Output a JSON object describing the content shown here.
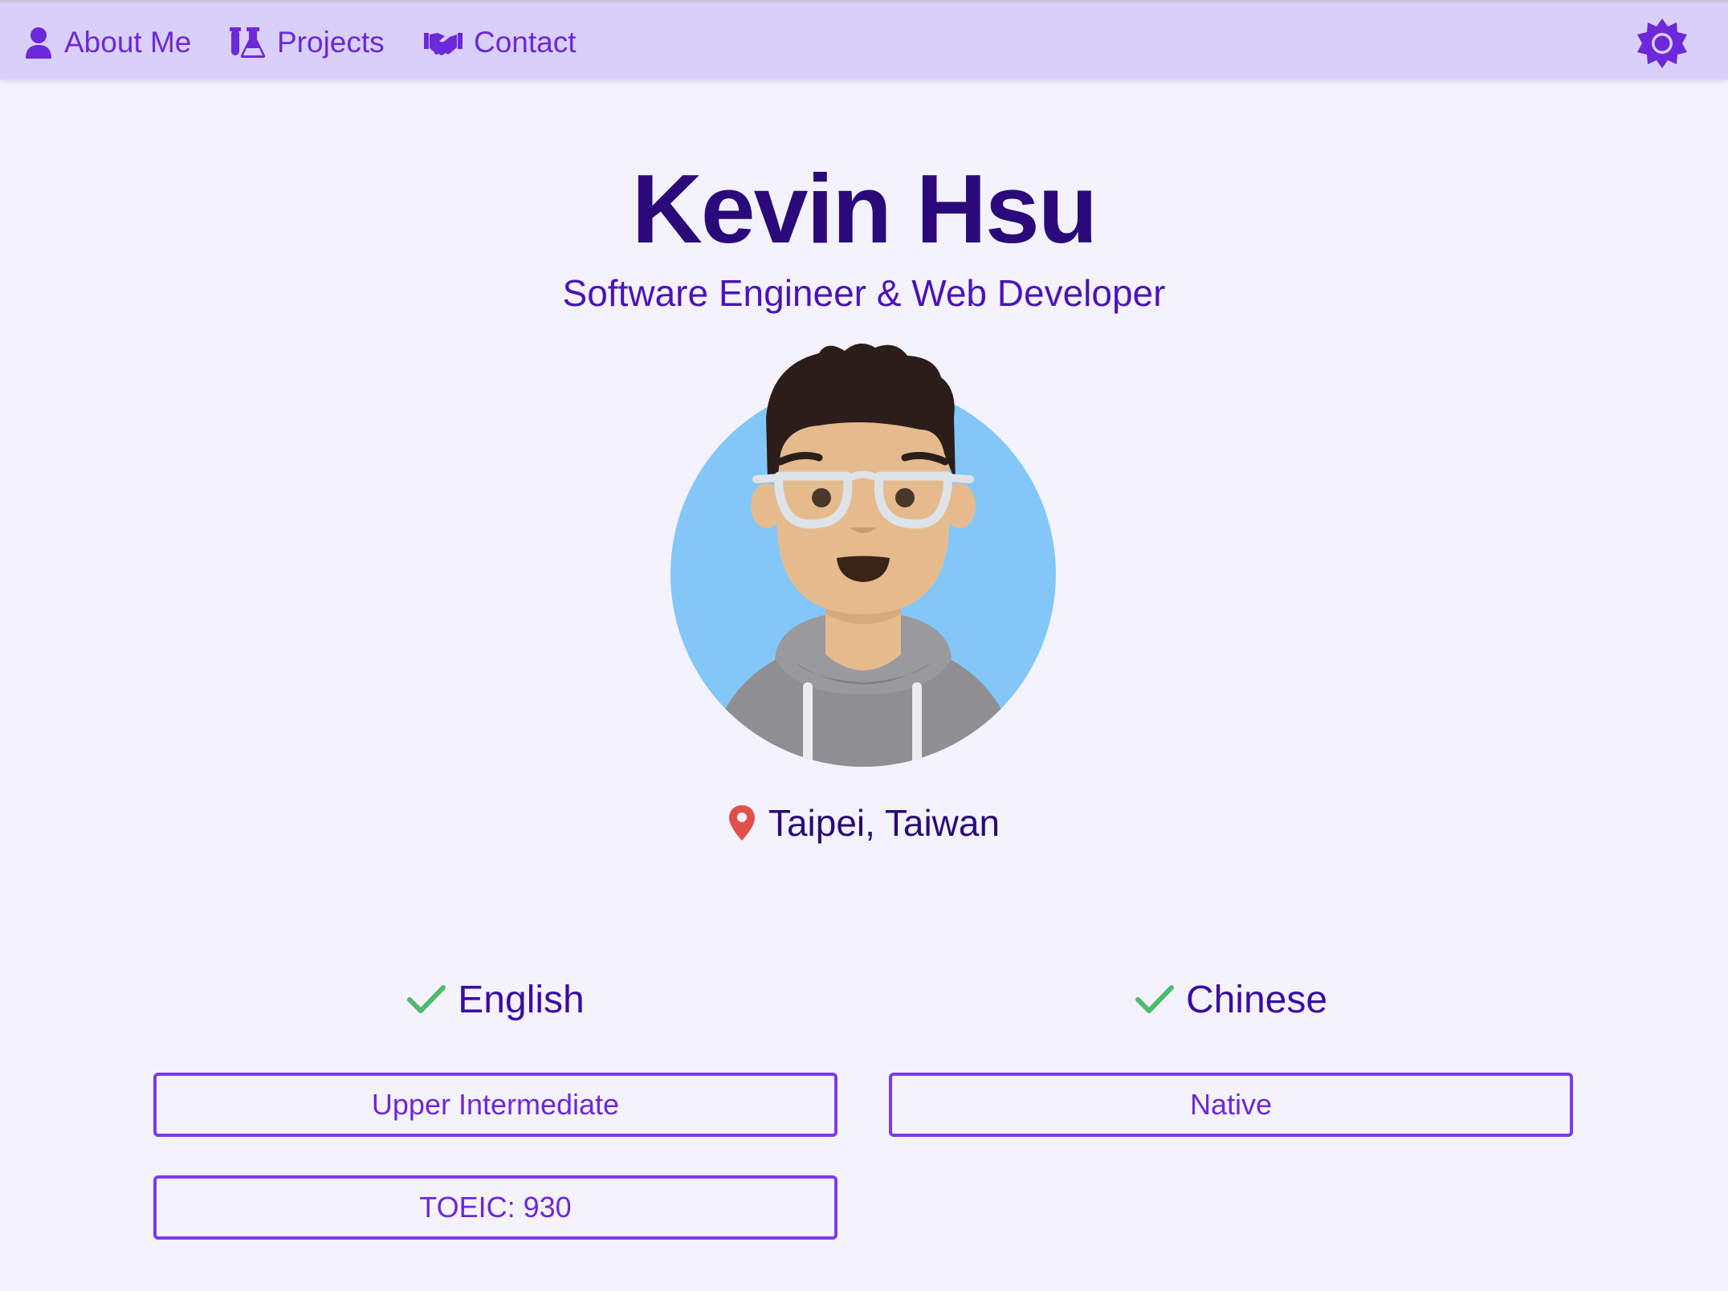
{
  "nav": {
    "items": [
      {
        "label": "About Me",
        "icon": "user-icon"
      },
      {
        "label": "Projects",
        "icon": "flask-icon"
      },
      {
        "label": "Contact",
        "icon": "handshake-icon"
      }
    ],
    "theme_toggle_icon": "sun-icon"
  },
  "profile": {
    "name": "Kevin Hsu",
    "title": "Software Engineer & Web Developer",
    "avatar_icon": "avatar-illustration",
    "location": "Taipei, Taiwan"
  },
  "languages": [
    {
      "name": "English",
      "badges": [
        "Upper Intermediate",
        "TOEIC: 930"
      ]
    },
    {
      "name": "Chinese",
      "badges": [
        "Native"
      ]
    }
  ],
  "colors": {
    "nav_bg": "#d8cffa",
    "page_bg": "#f4f2fc",
    "accent": "#6d28d9",
    "heading": "#2a0a7a",
    "check": "#4cbb6c",
    "pin": "#e0504a",
    "avatar_bg": "#82c7f8"
  }
}
